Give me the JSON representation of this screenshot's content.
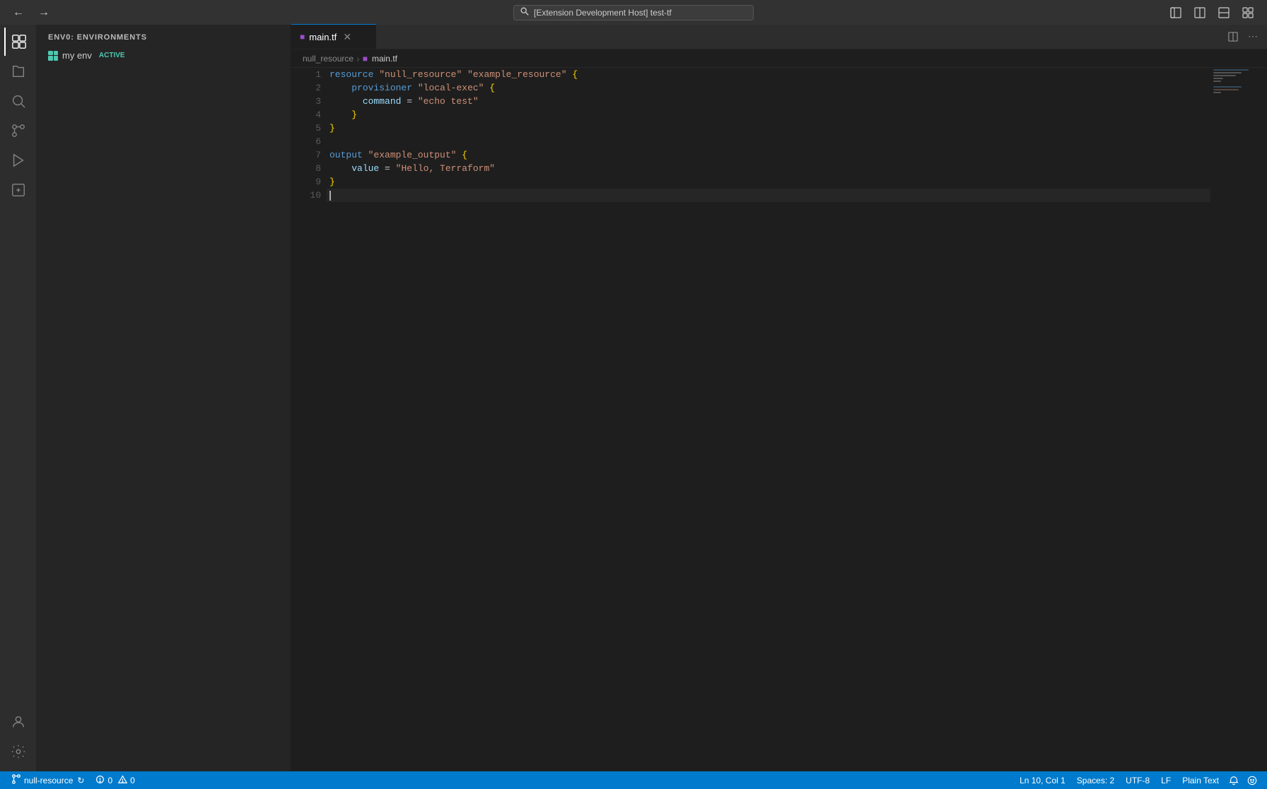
{
  "titlebar": {
    "search_placeholder": "[Extension Development Host] test-tf",
    "nav": {
      "back": "←",
      "forward": "→"
    }
  },
  "activity_bar": {
    "items": [
      {
        "name": "extensions",
        "icon": "⊞",
        "label": "Extensions"
      },
      {
        "name": "explorer",
        "icon": "📄",
        "label": "Explorer"
      },
      {
        "name": "search",
        "icon": "🔍",
        "label": "Search"
      },
      {
        "name": "source-control",
        "icon": "⎇",
        "label": "Source Control"
      },
      {
        "name": "run-debug",
        "icon": "▷",
        "label": "Run and Debug"
      },
      {
        "name": "extensions-bar",
        "icon": "⊡",
        "label": "Extensions"
      }
    ],
    "bottom": [
      {
        "name": "account",
        "icon": "👤",
        "label": "Account"
      },
      {
        "name": "settings",
        "icon": "⚙",
        "label": "Settings"
      }
    ]
  },
  "sidebar": {
    "title": "ENV0: ENVIRONMENTS",
    "items": [
      {
        "name": "my env",
        "status": "ACTIVE"
      }
    ]
  },
  "tab": {
    "filename": "main.tf",
    "icon": "tf"
  },
  "breadcrumb": {
    "parts": [
      "null_resource",
      "main.tf"
    ]
  },
  "code": {
    "lines": [
      {
        "num": 1,
        "text": "resource \"null_resource\" \"example_resource\" {",
        "tokens": [
          {
            "type": "kw",
            "val": "resource"
          },
          {
            "type": "op",
            "val": " "
          },
          {
            "type": "str",
            "val": "\"null_resource\""
          },
          {
            "type": "op",
            "val": " "
          },
          {
            "type": "str",
            "val": "\"example_resource\""
          },
          {
            "type": "op",
            "val": " "
          },
          {
            "type": "brace",
            "val": "{"
          }
        ]
      },
      {
        "num": 2,
        "text": "    provisioner \"local-exec\" {",
        "tokens": [
          {
            "type": "op",
            "val": "    "
          },
          {
            "type": "kw",
            "val": "provisioner"
          },
          {
            "type": "op",
            "val": " "
          },
          {
            "type": "str",
            "val": "\"local-exec\""
          },
          {
            "type": "op",
            "val": " "
          },
          {
            "type": "brace",
            "val": "{"
          }
        ]
      },
      {
        "num": 3,
        "text": "      command = \"echo test\"",
        "tokens": [
          {
            "type": "op",
            "val": "      "
          },
          {
            "type": "id",
            "val": "command"
          },
          {
            "type": "op",
            "val": " = "
          },
          {
            "type": "str",
            "val": "\"echo test\""
          }
        ]
      },
      {
        "num": 4,
        "text": "    }",
        "tokens": [
          {
            "type": "op",
            "val": "    "
          },
          {
            "type": "brace",
            "val": "}"
          }
        ]
      },
      {
        "num": 5,
        "text": "}",
        "tokens": [
          {
            "type": "brace",
            "val": "}"
          }
        ]
      },
      {
        "num": 6,
        "text": "",
        "tokens": []
      },
      {
        "num": 7,
        "text": "output \"example_output\" {",
        "tokens": [
          {
            "type": "kw",
            "val": "output"
          },
          {
            "type": "op",
            "val": " "
          },
          {
            "type": "str",
            "val": "\"example_output\""
          },
          {
            "type": "op",
            "val": " "
          },
          {
            "type": "brace",
            "val": "{"
          }
        ]
      },
      {
        "num": 8,
        "text": "    value = \"Hello, Terraform\"",
        "tokens": [
          {
            "type": "op",
            "val": "    "
          },
          {
            "type": "id",
            "val": "value"
          },
          {
            "type": "op",
            "val": " = "
          },
          {
            "type": "str",
            "val": "\"Hello, Terraform\""
          }
        ]
      },
      {
        "num": 9,
        "text": "}",
        "tokens": [
          {
            "type": "brace",
            "val": "}"
          }
        ]
      },
      {
        "num": 10,
        "text": "",
        "tokens": [],
        "cursor": true
      }
    ]
  },
  "status_bar": {
    "branch": "null-resource",
    "sync_icon": "↻",
    "errors": "0",
    "warnings": "0",
    "position": "Ln 10, Col 1",
    "spaces": "Spaces: 2",
    "encoding": "UTF-8",
    "line_ending": "LF",
    "language": "Plain Text",
    "notifications": "🔔",
    "feedback": "☺"
  }
}
